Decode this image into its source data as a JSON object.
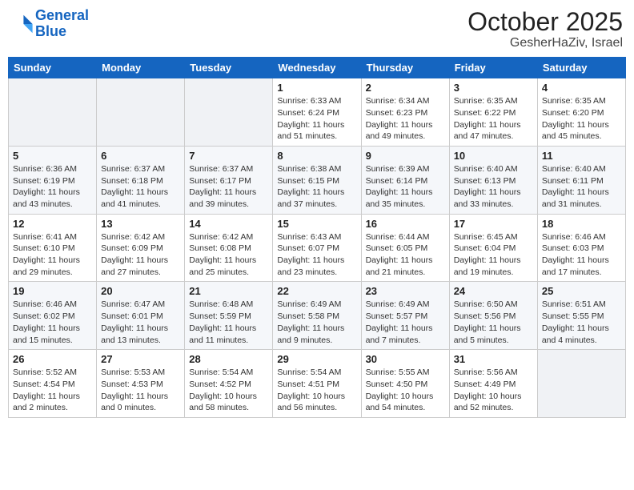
{
  "header": {
    "logo_line1": "General",
    "logo_line2": "Blue",
    "month": "October 2025",
    "location": "GesherHaZiv, Israel"
  },
  "weekdays": [
    "Sunday",
    "Monday",
    "Tuesday",
    "Wednesday",
    "Thursday",
    "Friday",
    "Saturday"
  ],
  "weeks": [
    [
      {
        "day": "",
        "info": ""
      },
      {
        "day": "",
        "info": ""
      },
      {
        "day": "",
        "info": ""
      },
      {
        "day": "1",
        "info": "Sunrise: 6:33 AM\nSunset: 6:24 PM\nDaylight: 11 hours\nand 51 minutes."
      },
      {
        "day": "2",
        "info": "Sunrise: 6:34 AM\nSunset: 6:23 PM\nDaylight: 11 hours\nand 49 minutes."
      },
      {
        "day": "3",
        "info": "Sunrise: 6:35 AM\nSunset: 6:22 PM\nDaylight: 11 hours\nand 47 minutes."
      },
      {
        "day": "4",
        "info": "Sunrise: 6:35 AM\nSunset: 6:20 PM\nDaylight: 11 hours\nand 45 minutes."
      }
    ],
    [
      {
        "day": "5",
        "info": "Sunrise: 6:36 AM\nSunset: 6:19 PM\nDaylight: 11 hours\nand 43 minutes."
      },
      {
        "day": "6",
        "info": "Sunrise: 6:37 AM\nSunset: 6:18 PM\nDaylight: 11 hours\nand 41 minutes."
      },
      {
        "day": "7",
        "info": "Sunrise: 6:37 AM\nSunset: 6:17 PM\nDaylight: 11 hours\nand 39 minutes."
      },
      {
        "day": "8",
        "info": "Sunrise: 6:38 AM\nSunset: 6:15 PM\nDaylight: 11 hours\nand 37 minutes."
      },
      {
        "day": "9",
        "info": "Sunrise: 6:39 AM\nSunset: 6:14 PM\nDaylight: 11 hours\nand 35 minutes."
      },
      {
        "day": "10",
        "info": "Sunrise: 6:40 AM\nSunset: 6:13 PM\nDaylight: 11 hours\nand 33 minutes."
      },
      {
        "day": "11",
        "info": "Sunrise: 6:40 AM\nSunset: 6:11 PM\nDaylight: 11 hours\nand 31 minutes."
      }
    ],
    [
      {
        "day": "12",
        "info": "Sunrise: 6:41 AM\nSunset: 6:10 PM\nDaylight: 11 hours\nand 29 minutes."
      },
      {
        "day": "13",
        "info": "Sunrise: 6:42 AM\nSunset: 6:09 PM\nDaylight: 11 hours\nand 27 minutes."
      },
      {
        "day": "14",
        "info": "Sunrise: 6:42 AM\nSunset: 6:08 PM\nDaylight: 11 hours\nand 25 minutes."
      },
      {
        "day": "15",
        "info": "Sunrise: 6:43 AM\nSunset: 6:07 PM\nDaylight: 11 hours\nand 23 minutes."
      },
      {
        "day": "16",
        "info": "Sunrise: 6:44 AM\nSunset: 6:05 PM\nDaylight: 11 hours\nand 21 minutes."
      },
      {
        "day": "17",
        "info": "Sunrise: 6:45 AM\nSunset: 6:04 PM\nDaylight: 11 hours\nand 19 minutes."
      },
      {
        "day": "18",
        "info": "Sunrise: 6:46 AM\nSunset: 6:03 PM\nDaylight: 11 hours\nand 17 minutes."
      }
    ],
    [
      {
        "day": "19",
        "info": "Sunrise: 6:46 AM\nSunset: 6:02 PM\nDaylight: 11 hours\nand 15 minutes."
      },
      {
        "day": "20",
        "info": "Sunrise: 6:47 AM\nSunset: 6:01 PM\nDaylight: 11 hours\nand 13 minutes."
      },
      {
        "day": "21",
        "info": "Sunrise: 6:48 AM\nSunset: 5:59 PM\nDaylight: 11 hours\nand 11 minutes."
      },
      {
        "day": "22",
        "info": "Sunrise: 6:49 AM\nSunset: 5:58 PM\nDaylight: 11 hours\nand 9 minutes."
      },
      {
        "day": "23",
        "info": "Sunrise: 6:49 AM\nSunset: 5:57 PM\nDaylight: 11 hours\nand 7 minutes."
      },
      {
        "day": "24",
        "info": "Sunrise: 6:50 AM\nSunset: 5:56 PM\nDaylight: 11 hours\nand 5 minutes."
      },
      {
        "day": "25",
        "info": "Sunrise: 6:51 AM\nSunset: 5:55 PM\nDaylight: 11 hours\nand 4 minutes."
      }
    ],
    [
      {
        "day": "26",
        "info": "Sunrise: 5:52 AM\nSunset: 4:54 PM\nDaylight: 11 hours\nand 2 minutes."
      },
      {
        "day": "27",
        "info": "Sunrise: 5:53 AM\nSunset: 4:53 PM\nDaylight: 11 hours\nand 0 minutes."
      },
      {
        "day": "28",
        "info": "Sunrise: 5:54 AM\nSunset: 4:52 PM\nDaylight: 10 hours\nand 58 minutes."
      },
      {
        "day": "29",
        "info": "Sunrise: 5:54 AM\nSunset: 4:51 PM\nDaylight: 10 hours\nand 56 minutes."
      },
      {
        "day": "30",
        "info": "Sunrise: 5:55 AM\nSunset: 4:50 PM\nDaylight: 10 hours\nand 54 minutes."
      },
      {
        "day": "31",
        "info": "Sunrise: 5:56 AM\nSunset: 4:49 PM\nDaylight: 10 hours\nand 52 minutes."
      },
      {
        "day": "",
        "info": ""
      }
    ]
  ]
}
